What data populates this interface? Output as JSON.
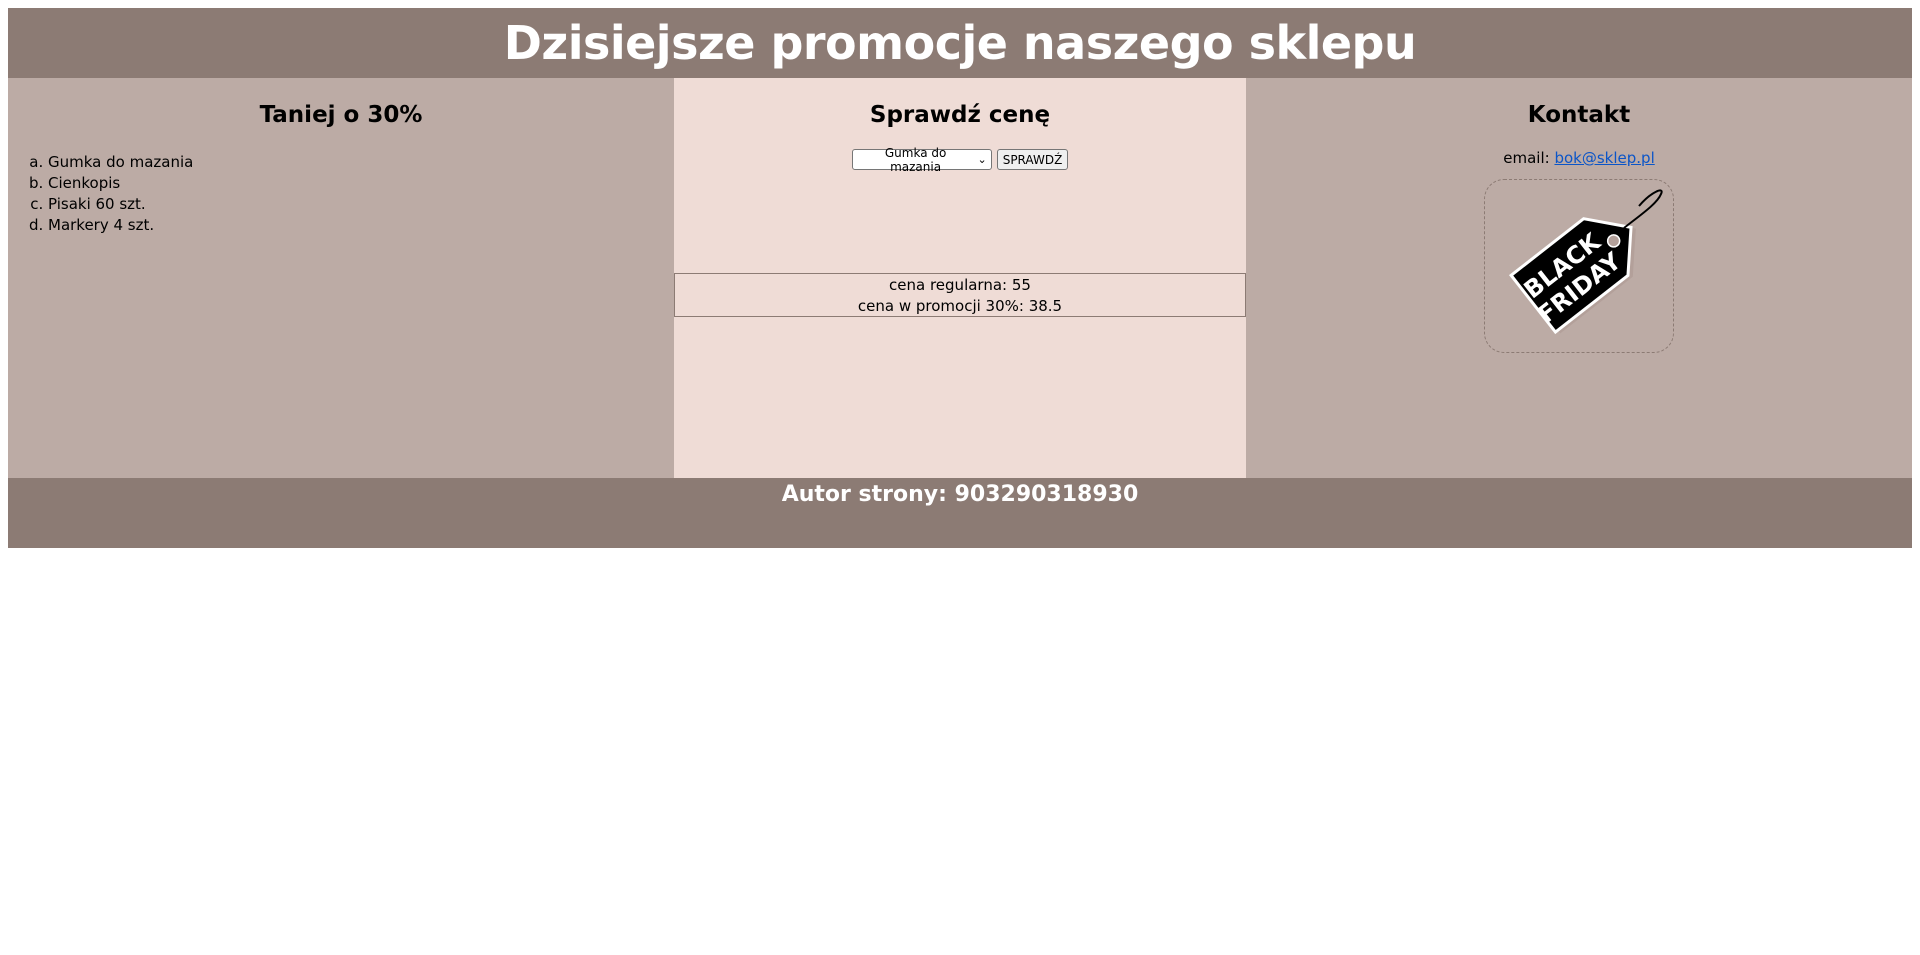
{
  "header": {
    "title": "Dzisiejsze promocje naszego sklepu"
  },
  "left": {
    "heading": "Taniej o 30%",
    "items": [
      "Gumka do mazania",
      "Cienkopis",
      "Pisaki 60 szt.",
      "Markery 4 szt."
    ]
  },
  "middle": {
    "heading": "Sprawdź cenę",
    "select_value": "Gumka do mazania",
    "button_label": "SPRAWDŹ",
    "result_line1": "cena regularna: 55",
    "result_line2": "cena w promocji 30%: 38.5"
  },
  "right": {
    "heading": "Kontakt",
    "email_label": "email: ",
    "email": "bok@sklep.pl",
    "tag_line1": "BLACK",
    "tag_line2": "FRIDAY"
  },
  "footer": {
    "author": "Autor strony: 903290318930"
  },
  "colors": {
    "banner": "#8c7b74",
    "side_panels": "#bcaba5",
    "middle_panel": "#efdcd6",
    "link": "#0b55c8"
  }
}
